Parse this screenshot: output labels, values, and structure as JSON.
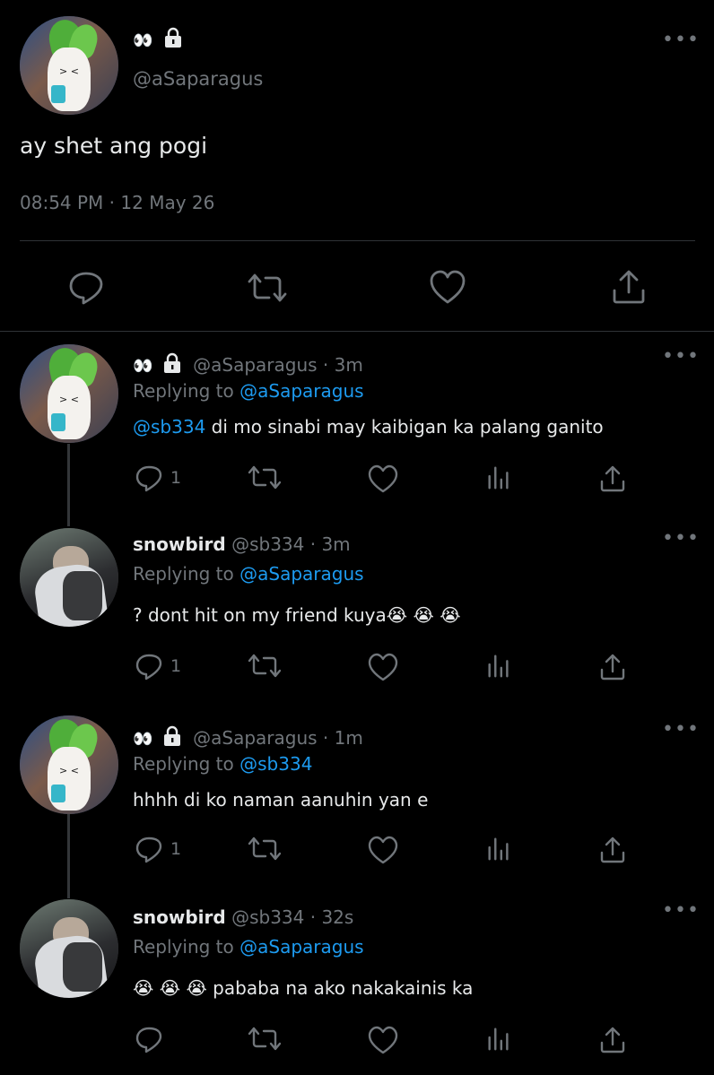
{
  "main_tweet": {
    "display_name": "👀",
    "handle": "@aSaparagus",
    "text": "ay shet ang pogi",
    "timestamp": "08:54 PM · 12 May 26"
  },
  "replies": [
    {
      "display_name": "👀",
      "handle_time": "@aSaparagus · 3m",
      "replying_prefix": "Replying to",
      "replying_to": "@aSaparagus",
      "mention": "@sb334",
      "text": "di mo sinabi may kaibigan ka palang ganito",
      "reply_count": "1"
    },
    {
      "display_name": "snowbird",
      "handle_time": "@sb334 · 3m",
      "replying_prefix": "Replying to",
      "replying_to": "@aSaparagus",
      "text": "? dont hit on my friend kuya😭 😭 😭",
      "reply_count": "1"
    },
    {
      "display_name": "👀",
      "handle_time": "@aSaparagus · 1m",
      "replying_prefix": "Replying to",
      "replying_to": "@sb334",
      "text": "hhhh di ko naman aanuhin yan e",
      "reply_count": "1"
    },
    {
      "display_name": "snowbird",
      "handle_time": "@sb334 · 32s",
      "replying_prefix": "Replying to",
      "replying_to": "@aSaparagus",
      "text": "😭 😭 😭  pababa na ako nakakainis ka",
      "reply_count": ""
    }
  ],
  "icons": {
    "lock": "lock-icon",
    "reply": "reply-icon",
    "retweet": "retweet-icon",
    "like": "heart-icon",
    "share": "share-icon",
    "views": "analytics-icon",
    "more": "more-icon"
  },
  "colors": {
    "background": "#000000",
    "text": "#e7e9ea",
    "muted": "#71767b",
    "link": "#1d9bf0"
  }
}
